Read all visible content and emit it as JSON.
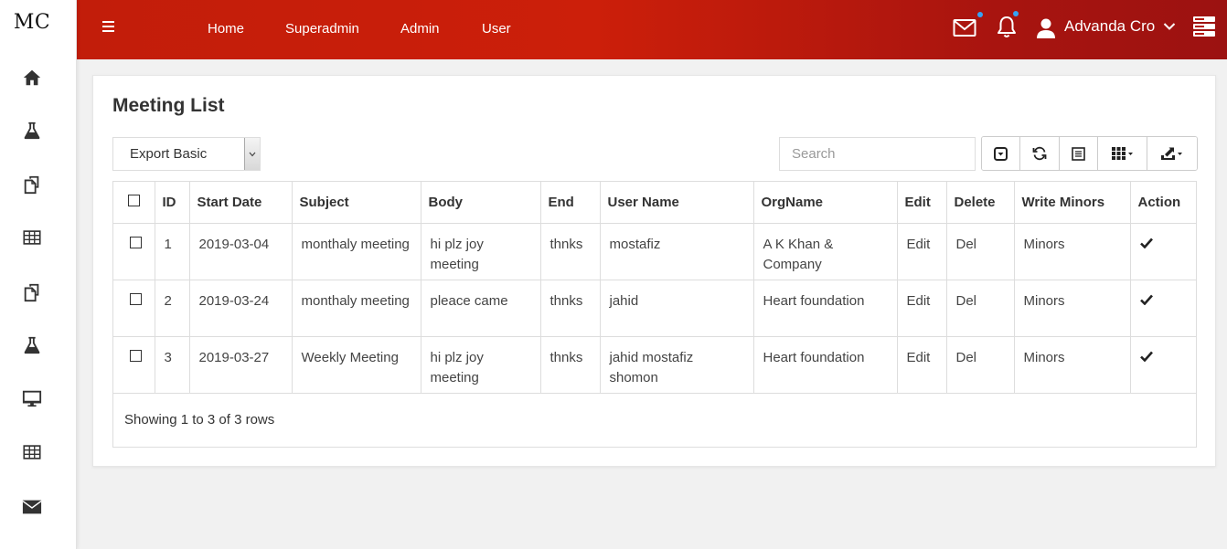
{
  "sidebar": {
    "logo": "MC",
    "items": [
      {
        "icon": "home-icon"
      },
      {
        "icon": "flask-icon"
      },
      {
        "icon": "copy-icon"
      },
      {
        "icon": "table-icon"
      },
      {
        "icon": "copy-icon"
      },
      {
        "icon": "flask-icon"
      },
      {
        "icon": "monitor-icon"
      },
      {
        "icon": "table-icon"
      },
      {
        "icon": "envelope-icon"
      }
    ]
  },
  "topbar": {
    "nav": [
      "Home",
      "Superadmin",
      "Admin",
      "User"
    ],
    "user_name": "Advanda Cro",
    "colors": {
      "start": "#c21d0a",
      "end": "#9c1211",
      "badge": "#35a3f5"
    }
  },
  "page": {
    "title": "Meeting List",
    "export_label": "Export Basic",
    "search_placeholder": "Search"
  },
  "table": {
    "columns": [
      "",
      "ID",
      "Start Date",
      "Subject",
      "Body",
      "End",
      "User Name",
      "OrgName",
      "Edit",
      "Delete",
      "Write Minors",
      "Action"
    ],
    "rows": [
      {
        "id": "1",
        "start_date": "2019-03-04",
        "subject": "monthaly meeting",
        "body": "hi plz joy meeting",
        "end": "thnks",
        "user_name": "mostafiz",
        "org": "A K Khan & Company",
        "edit": "Edit",
        "delete": "Del",
        "minors": "Minors"
      },
      {
        "id": "2",
        "start_date": "2019-03-24",
        "subject": "monthaly meeting",
        "body": "pleace came",
        "end": "thnks",
        "user_name": "jahid",
        "org": "Heart foundation",
        "edit": "Edit",
        "delete": "Del",
        "minors": "Minors"
      },
      {
        "id": "3",
        "start_date": "2019-03-27",
        "subject": "Weekly Meeting",
        "body": "hi plz joy meeting",
        "end": "thnks",
        "user_name": "jahid mostafiz shomon",
        "org": "Heart foundation",
        "edit": "Edit",
        "delete": "Del",
        "minors": "Minors"
      }
    ],
    "footer": "Showing 1 to 3 of 3 rows"
  }
}
